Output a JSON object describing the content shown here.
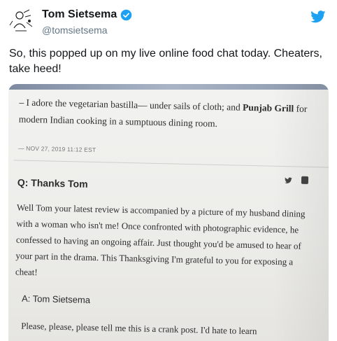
{
  "tweet": {
    "author_name": "Tom Sietsema",
    "author_handle": "@tomsietsema",
    "text": "So, this popped up on my live online food chat today. Cheaters, take heed!",
    "brand_color": "#1da1f2"
  },
  "photo": {
    "para1_start": "– I adore the vegetarian bastilla— under sails of cloth; and ",
    "para1_bold": "Punjab Grill",
    "para1_end": " for modern Indian cooking in a sumptuous dining room.",
    "timestamp": "— NOV 27, 2019 11:12 EST",
    "question_title": "Q: Thanks Tom",
    "question_body": "Well Tom your latest review is accompanied by a picture of my husband dining with a woman who isn't me! Once confronted with photographic evidence, he confessed to having an ongoing affair. Just thought you'd be amused to hear of your part in the drama. This Thanksgiving I'm grateful to you for exposing a cheat!",
    "answer_title": "A: Tom Sietsema",
    "answer_body": "Please, please, please tell me this is a crank post. I'd hate to learn"
  }
}
